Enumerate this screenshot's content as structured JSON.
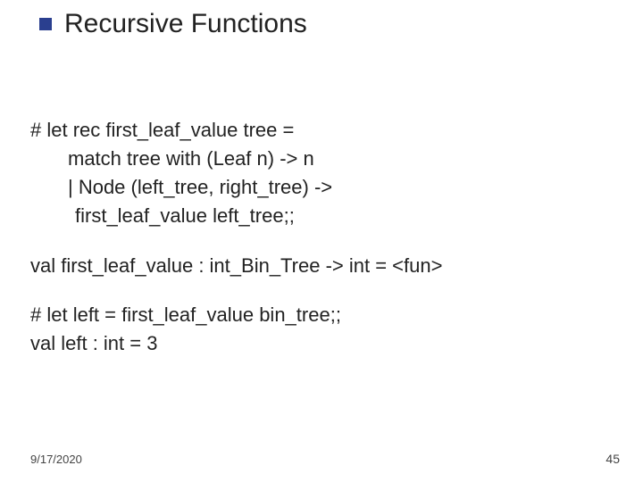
{
  "title": "Recursive Functions",
  "code": {
    "l1": "# let rec first_leaf_value tree =",
    "l2": "match tree with (Leaf n) -> n",
    "l3": "| Node (left_tree, right_tree) ->",
    "l4": "first_leaf_value left_tree;;",
    "l5": "val first_leaf_value : int_Bin_Tree -> int = <fun>",
    "l6": "# let left = first_leaf_value bin_tree;;",
    "l7": "val left : int = 3"
  },
  "footer": {
    "date": "9/17/2020",
    "page": "45"
  }
}
